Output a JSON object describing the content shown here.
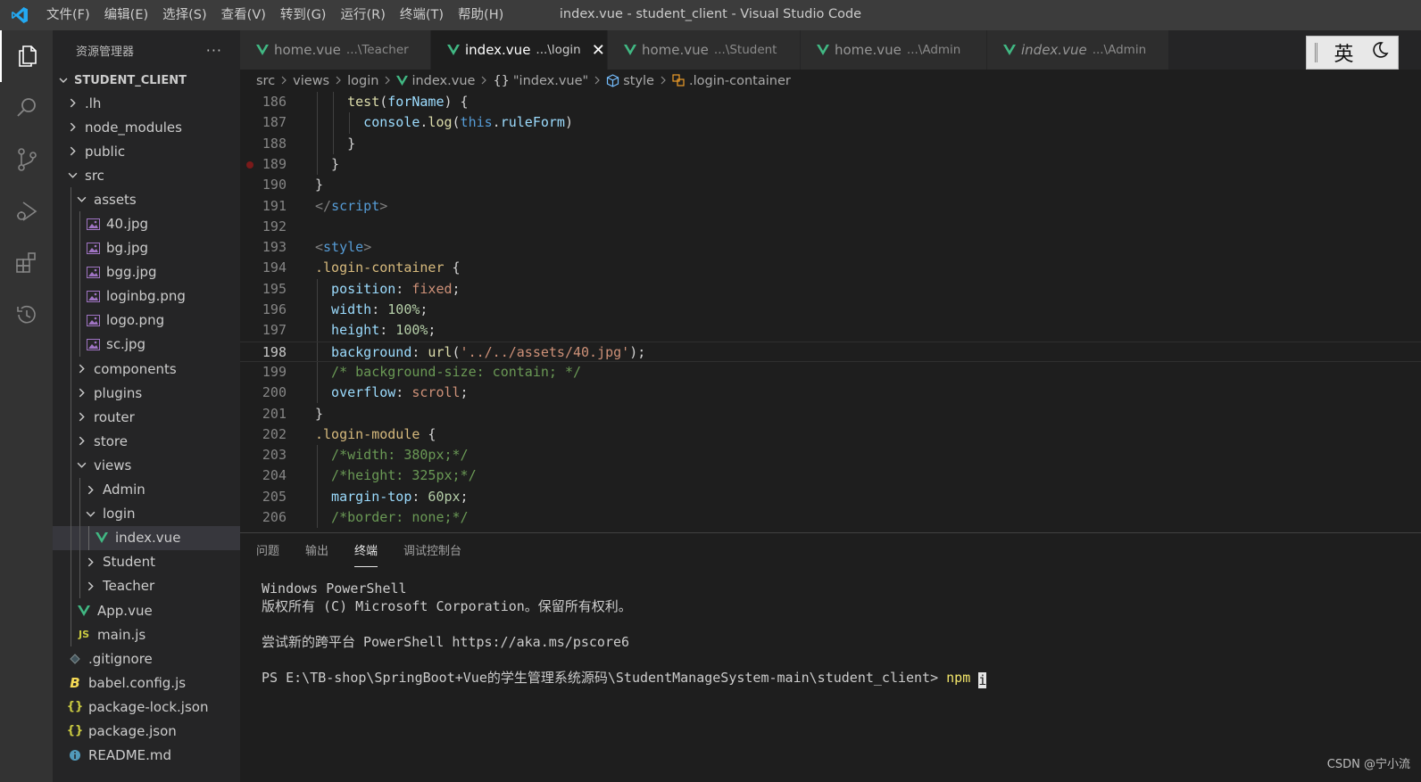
{
  "window": {
    "title": "index.vue - student_client - Visual Studio Code",
    "menu": [
      "文件(F)",
      "编辑(E)",
      "选择(S)",
      "查看(V)",
      "转到(G)",
      "运行(R)",
      "终端(T)",
      "帮助(H)"
    ]
  },
  "activity_bar": [
    "explorer-icon",
    "search-icon",
    "source-control-icon",
    "run-debug-icon",
    "extensions-icon",
    "timeline-icon"
  ],
  "sidebar": {
    "header": "资源管理器",
    "more": "···",
    "root": "STUDENT_CLIENT",
    "tree": [
      {
        "label": ".lh",
        "kind": "folder",
        "open": false,
        "depth": 1
      },
      {
        "label": "node_modules",
        "kind": "folder",
        "open": false,
        "depth": 1
      },
      {
        "label": "public",
        "kind": "folder",
        "open": false,
        "depth": 1
      },
      {
        "label": "src",
        "kind": "folder",
        "open": true,
        "depth": 1
      },
      {
        "label": "assets",
        "kind": "folder",
        "open": true,
        "depth": 2
      },
      {
        "label": "40.jpg",
        "kind": "image",
        "depth": 3
      },
      {
        "label": "bg.jpg",
        "kind": "image",
        "depth": 3
      },
      {
        "label": "bgg.jpg",
        "kind": "image",
        "depth": 3
      },
      {
        "label": "loginbg.png",
        "kind": "image",
        "depth": 3
      },
      {
        "label": "logo.png",
        "kind": "image",
        "depth": 3
      },
      {
        "label": "sc.jpg",
        "kind": "image",
        "depth": 3
      },
      {
        "label": "components",
        "kind": "folder",
        "open": false,
        "depth": 2
      },
      {
        "label": "plugins",
        "kind": "folder",
        "open": false,
        "depth": 2
      },
      {
        "label": "router",
        "kind": "folder",
        "open": false,
        "depth": 2
      },
      {
        "label": "store",
        "kind": "folder",
        "open": false,
        "depth": 2
      },
      {
        "label": "views",
        "kind": "folder",
        "open": true,
        "depth": 2
      },
      {
        "label": "Admin",
        "kind": "folder",
        "open": false,
        "depth": 3
      },
      {
        "label": "login",
        "kind": "folder",
        "open": true,
        "depth": 3
      },
      {
        "label": "index.vue",
        "kind": "vue",
        "depth": 4,
        "selected": true
      },
      {
        "label": "Student",
        "kind": "folder",
        "open": false,
        "depth": 3
      },
      {
        "label": "Teacher",
        "kind": "folder",
        "open": false,
        "depth": 3
      },
      {
        "label": "App.vue",
        "kind": "vue",
        "depth": 2
      },
      {
        "label": "main.js",
        "kind": "js",
        "depth": 2
      },
      {
        "label": ".gitignore",
        "kind": "git",
        "depth": 1
      },
      {
        "label": "babel.config.js",
        "kind": "babel",
        "depth": 1
      },
      {
        "label": "package-lock.json",
        "kind": "json",
        "depth": 1
      },
      {
        "label": "package.json",
        "kind": "json",
        "depth": 1
      },
      {
        "label": "README.md",
        "kind": "info",
        "depth": 1
      }
    ]
  },
  "tabs": [
    {
      "name": "home.vue",
      "desc": "...\\Teacher",
      "active": false,
      "italic": false
    },
    {
      "name": "index.vue",
      "desc": "...\\login",
      "active": true,
      "italic": false,
      "close": "✕"
    },
    {
      "name": "home.vue",
      "desc": "...\\Student",
      "active": false,
      "italic": false
    },
    {
      "name": "home.vue",
      "desc": "...\\Admin",
      "active": false,
      "italic": false
    },
    {
      "name": "index.vue",
      "desc": "...\\Admin",
      "active": false,
      "italic": true
    }
  ],
  "ime": {
    "mode": "英",
    "theme_icon": "moon-icon"
  },
  "breadcrumb": [
    "src",
    "views",
    "login",
    "index.vue",
    "\"index.vue\"",
    "style",
    ".login-container"
  ],
  "editor": {
    "current_line": "198",
    "breakpoint_line": "189",
    "lines": [
      {
        "n": "186",
        "indent": 2,
        "tokens": [
          [
            "fn",
            "test"
          ],
          [
            "txt",
            "("
          ],
          [
            "var",
            "forName"
          ],
          [
            "txt",
            ") {"
          ]
        ]
      },
      {
        "n": "187",
        "indent": 3,
        "tokens": [
          [
            "var",
            "console"
          ],
          [
            "txt",
            "."
          ],
          [
            "fn",
            "log"
          ],
          [
            "txt",
            "("
          ],
          [
            "kw",
            "this"
          ],
          [
            "txt",
            "."
          ],
          [
            "var",
            "ruleForm"
          ],
          [
            "txt",
            ")"
          ]
        ]
      },
      {
        "n": "188",
        "indent": 2,
        "tokens": [
          [
            "txt",
            "}"
          ]
        ]
      },
      {
        "n": "189",
        "indent": 1,
        "tokens": [
          [
            "txt",
            "}"
          ]
        ]
      },
      {
        "n": "190",
        "indent": 0,
        "tokens": [
          [
            "txt",
            "}"
          ]
        ]
      },
      {
        "n": "191",
        "indent": 0,
        "tokens": [
          [
            "tag",
            "</"
          ],
          [
            "tagn",
            "script"
          ],
          [
            "tag",
            ">"
          ]
        ]
      },
      {
        "n": "192",
        "indent": 0,
        "tokens": []
      },
      {
        "n": "193",
        "indent": 0,
        "tokens": [
          [
            "tag",
            "<"
          ],
          [
            "tagn",
            "style"
          ],
          [
            "tag",
            ">"
          ]
        ]
      },
      {
        "n": "194",
        "indent": 0,
        "tokens": [
          [
            "sel",
            ".login-container"
          ],
          [
            "txt",
            " {"
          ]
        ]
      },
      {
        "n": "195",
        "indent": 1,
        "tokens": [
          [
            "prop",
            "position"
          ],
          [
            "txt",
            ": "
          ],
          [
            "val",
            "fixed"
          ],
          [
            "txt",
            ";"
          ]
        ]
      },
      {
        "n": "196",
        "indent": 1,
        "tokens": [
          [
            "prop",
            "width"
          ],
          [
            "txt",
            ": "
          ],
          [
            "num",
            "100%"
          ],
          [
            "txt",
            ";"
          ]
        ]
      },
      {
        "n": "197",
        "indent": 1,
        "tokens": [
          [
            "prop",
            "height"
          ],
          [
            "txt",
            ": "
          ],
          [
            "num",
            "100%"
          ],
          [
            "txt",
            ";"
          ]
        ]
      },
      {
        "n": "198",
        "indent": 1,
        "tokens": [
          [
            "prop",
            "background"
          ],
          [
            "txt",
            ": "
          ],
          [
            "fn",
            "url"
          ],
          [
            "brk",
            "("
          ],
          [
            "str",
            "'../../assets/40.jpg'"
          ],
          [
            "brk",
            ")"
          ],
          [
            "txt",
            ";"
          ]
        ]
      },
      {
        "n": "199",
        "indent": 1,
        "tokens": [
          [
            "com",
            "/* background-size: contain; */"
          ]
        ]
      },
      {
        "n": "200",
        "indent": 1,
        "tokens": [
          [
            "prop",
            "overflow"
          ],
          [
            "txt",
            ": "
          ],
          [
            "val",
            "scroll"
          ],
          [
            "txt",
            ";"
          ]
        ]
      },
      {
        "n": "201",
        "indent": 0,
        "tokens": [
          [
            "txt",
            "}"
          ]
        ]
      },
      {
        "n": "202",
        "indent": 0,
        "tokens": [
          [
            "sel",
            ".login-module"
          ],
          [
            "txt",
            " {"
          ]
        ]
      },
      {
        "n": "203",
        "indent": 1,
        "tokens": [
          [
            "com",
            "/*width: 380px;*/"
          ]
        ]
      },
      {
        "n": "204",
        "indent": 1,
        "tokens": [
          [
            "com",
            "/*height: 325px;*/"
          ]
        ]
      },
      {
        "n": "205",
        "indent": 1,
        "tokens": [
          [
            "prop",
            "margin-top"
          ],
          [
            "txt",
            ": "
          ],
          [
            "num",
            "60px"
          ],
          [
            "txt",
            ";"
          ]
        ]
      },
      {
        "n": "206",
        "indent": 1,
        "tokens": [
          [
            "com",
            "/*border: none;*/"
          ]
        ]
      }
    ]
  },
  "panel": {
    "tabs": [
      "问题",
      "输出",
      "终端",
      "调试控制台"
    ],
    "active_tab": "终端",
    "terminal": {
      "lines": [
        "Windows PowerShell",
        "版权所有 (C) Microsoft Corporation。保留所有权利。",
        "",
        "尝试新的跨平台 PowerShell https://aka.ms/pscore6",
        ""
      ],
      "prompt": "PS E:\\TB-shop\\SpringBoot+Vue的学生管理系统源码\\StudentManageSystem-main\\student_client> ",
      "command": "npm i"
    }
  },
  "watermark": "CSDN @宁小流",
  "colors": {
    "vue_green": "#41b883",
    "image_purple": "#a074c4",
    "js_yellow": "#cbcb41",
    "accent": "#007acc"
  }
}
